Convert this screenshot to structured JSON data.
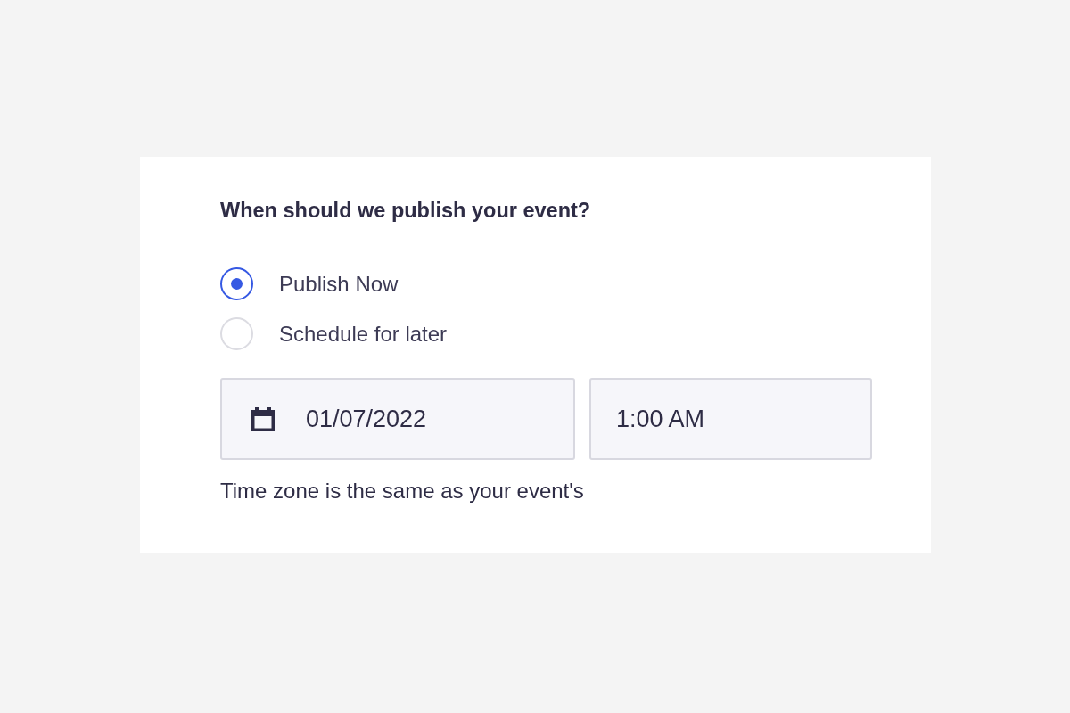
{
  "question": "When should we publish your event?",
  "options": [
    {
      "label": "Publish Now",
      "selected": true
    },
    {
      "label": "Schedule for later",
      "selected": false
    }
  ],
  "date_field": {
    "value": "01/07/2022"
  },
  "time_field": {
    "value": "1:00 AM"
  },
  "note": "Time zone is the same as your event's"
}
